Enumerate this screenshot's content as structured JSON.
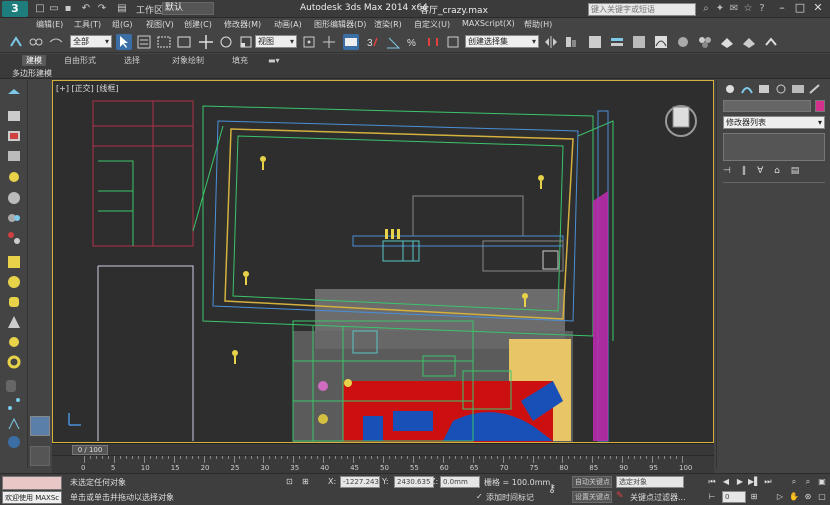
{
  "title_bar": {
    "workspace_label": "工作区:",
    "workspace_value": "默认",
    "app_title": "Autodesk 3ds Max  2014 x64",
    "file_name": "客厅_crazy.max",
    "search_placeholder": "键入关键字或短语"
  },
  "menu": [
    "编辑(E)",
    "工具(T)",
    "组(G)",
    "视图(V)",
    "创建(C)",
    "修改器(M)",
    "动画(A)",
    "图形编辑器(D)",
    "渲染(R)",
    "自定义(U)",
    "MAXScript(X)",
    "帮助(H)"
  ],
  "toolbar": {
    "selection_filter": "全部",
    "ref_coord": "视图",
    "named_selection": "创建选择集"
  },
  "ribbon": {
    "tabs": [
      "建模",
      "自由形式",
      "选择",
      "对象绘制",
      "填充"
    ],
    "active_tab": "建模",
    "sub_label": "多边形建模"
  },
  "viewport": {
    "label": "[+] [正交] [线框]"
  },
  "command_panel": {
    "modifier_list": "修改器列表",
    "object_color": "#d6308d"
  },
  "timeline": {
    "frame_display": "0 / 100",
    "ticks": [
      "0",
      "5",
      "10",
      "15",
      "20",
      "25",
      "30",
      "35",
      "40",
      "45",
      "50",
      "55",
      "60",
      "65",
      "70",
      "75",
      "80",
      "85",
      "90",
      "95",
      "100"
    ]
  },
  "status": {
    "welcome": "欢迎使用 MAXSc",
    "selection_status": "未选定任何对象",
    "prompt": "单击或单击并拖动以选择对象",
    "x_label": "X:",
    "x_value": "-1227.243",
    "y_label": "Y:",
    "y_value": "2430.635",
    "z_label": "Z:",
    "z_value": "0.0mm",
    "grid": "栅格 = 100.0mm",
    "add_time_tag": "添加时间标记",
    "auto_key": "自动关键点",
    "set_key": "设置关键点",
    "selected_object": "选定对象",
    "key_filters": "关键点过滤器...",
    "frame_value": "0"
  }
}
